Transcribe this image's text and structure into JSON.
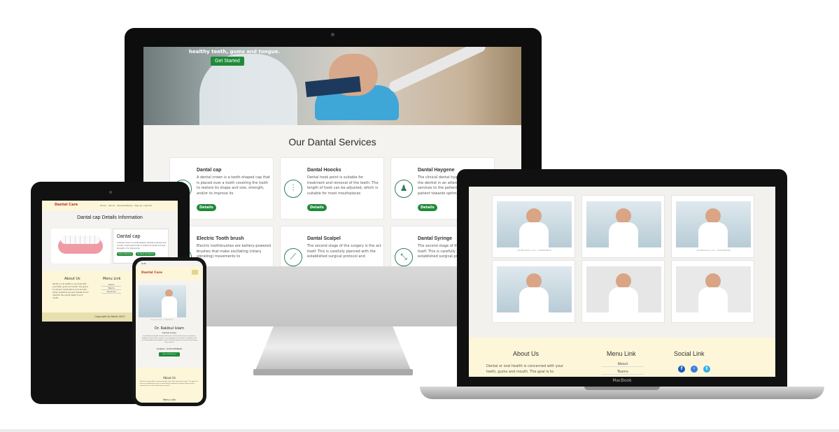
{
  "imac": {
    "hero_text": "healthy teeth, gums and tongue.",
    "hero_button": "Get Started",
    "section_title": "Our Dantal Services",
    "services": [
      {
        "name": "Dantal cap",
        "icon": "tooth-icon",
        "desc": "A dental crown is a tooth-shaped cap that is placed over a tooth covering the tooth to restore its shape and size, strength, and/or to improve its",
        "button": "Details"
      },
      {
        "name": "Dantal Hoocks",
        "icon": "dental-hooks-icon",
        "desc": "Dental hook point is suitable for treatment and removal of the teeth. The length of hook can be adjusted, which is suitable for most mouthpieces",
        "button": "Details"
      },
      {
        "name": "Dantal Haygene",
        "icon": "hygiene-icon",
        "desc": "The clinical dental hygienist works with the dentist in an attempt to provide services to the patient, and toward the patient towards optimal",
        "button": "Details"
      },
      {
        "name": "Electric Tooth brush",
        "icon": "toothbrush-icon",
        "desc": "Electric toothbrushes are battery-powered brushes that make oscillating (rotary vibrating) movements to"
      },
      {
        "name": "Dantal Scalpel",
        "icon": "scalpel-icon",
        "desc": "The second stage of the surgery is the act itself. This is carefully planned with the established surgical protocol and"
      },
      {
        "name": "Dantal Syringe",
        "icon": "syringe-icon",
        "desc": "The second stage of the surgery is the act itself. This is carefully planned with the established surgical protocol and"
      }
    ]
  },
  "macbook": {
    "label": "MacBook",
    "team_captions": [
      "shutterstock.com · 1768050878",
      "",
      "shutterstock.com · 1020385936",
      "",
      "",
      ""
    ],
    "footer": {
      "about_title": "About Us",
      "about_text": "Dental or oral health is concerned with your teeth, gums and mouth. The goal is to",
      "menu_title": "Menu Link",
      "menu_items": [
        "About",
        "Teams"
      ],
      "social_title": "Social Link"
    }
  },
  "ipad": {
    "logo": "Dantal Care",
    "nav": [
      "Home",
      "About",
      "Services",
      "Teams",
      "Sign up",
      "Log Out"
    ],
    "page_title": "Dantal cap Details Information",
    "card_title": "Dantal cap",
    "card_desc": "A dental crown is a tooth-shaped cap that is placed over a tooth covering the tooth to restore its shape and size, strength, or to improve its",
    "card_btn1": "Online Booking",
    "card_btn2": "Go Back All Service",
    "about_title": "About Us",
    "about_text": "Dental or oral health is concerned with your teeth, gums and mouth. The goal is to prevent complications such as tooth decay, problems and gum disease and to maintain the overall health of your mouth.",
    "menu_title": "Menu Link",
    "menu_items": [
      "About",
      "Teams",
      "Services"
    ],
    "copyright": "Copyright by Rakib 2021"
  },
  "iphone": {
    "time": "9:41",
    "logo": "Dantal Care",
    "image_caption": "shutterstock.com · 1768050878",
    "doctor_name": "Dr. Rakibul Islam",
    "role": "Dental Surgn",
    "desc": "From Business English lessons with tests, articles and exercises to practice English the best way to master a new language is to practice it regularly, and the following Business English courses will help anyone interested in becoming fluent also to",
    "contact": "Contact : 0123-5558222",
    "button": "Back to All Doctors",
    "about_title": "About Us",
    "about_text": "Dental or oral health is concerned with your teeth, gums and mouth. The goal is to prevent complications such as tooth decay, problems and gum disease and to maintain the overall health of your mouth.",
    "menu_title": "Menu Link"
  },
  "colors": {
    "accent_green": "#1f8a3a",
    "footer_cream": "#fdf6d9",
    "brand_red": "#b8322f"
  }
}
